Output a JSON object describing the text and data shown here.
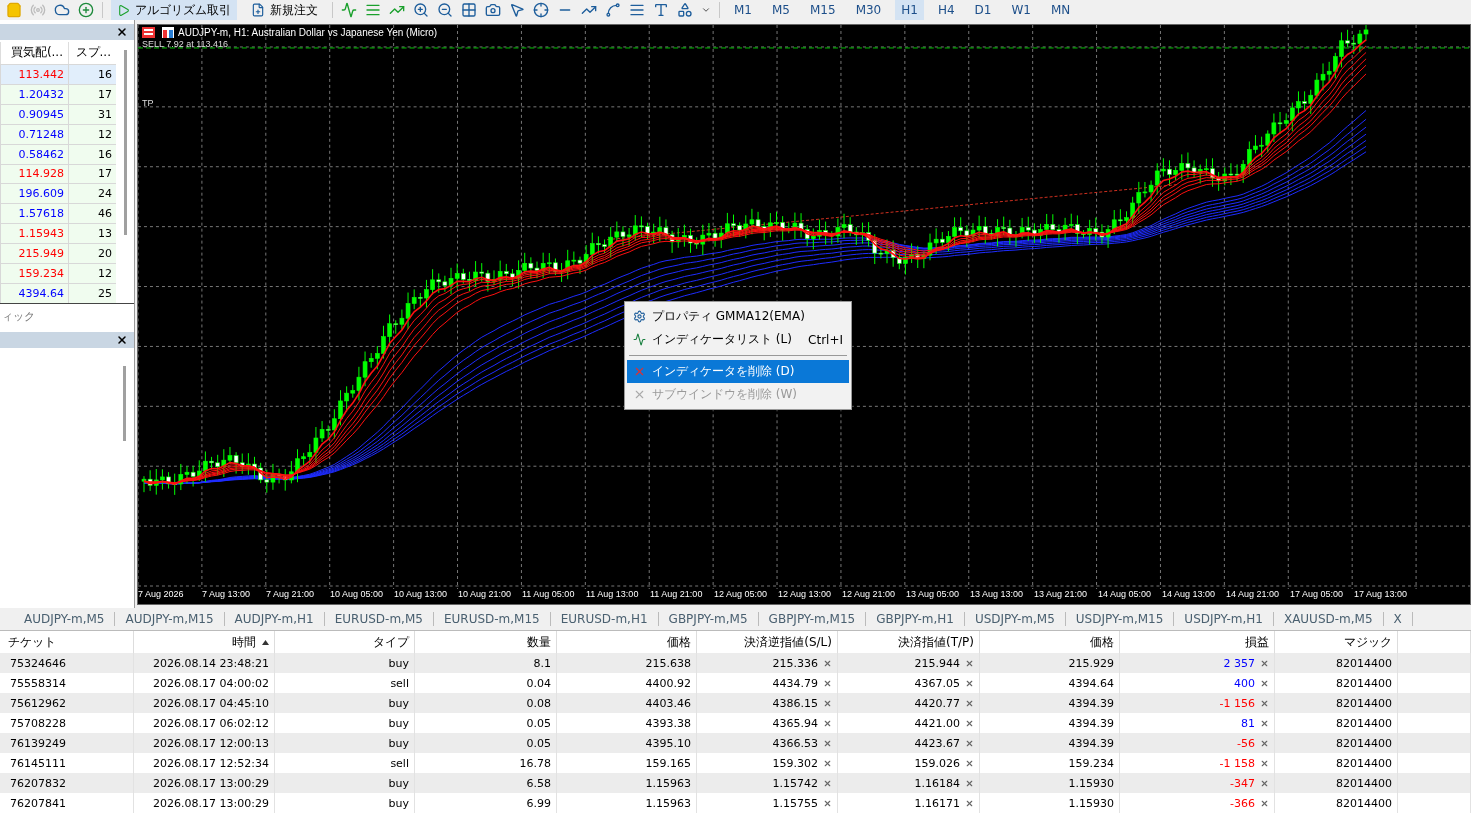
{
  "toolbar": {
    "buttons": [
      {
        "label": "アルゴリズム取引",
        "kind": "algo"
      },
      {
        "label": "新規注文",
        "kind": "order"
      }
    ],
    "timeframes": [
      {
        "label": "M1",
        "selected": false
      },
      {
        "label": "M5",
        "selected": false
      },
      {
        "label": "M15",
        "selected": false
      },
      {
        "label": "M30",
        "selected": false
      },
      {
        "label": "H1",
        "selected": true
      },
      {
        "label": "H4",
        "selected": false
      },
      {
        "label": "D1",
        "selected": false
      },
      {
        "label": "W1",
        "selected": false
      },
      {
        "label": "MN",
        "selected": false
      }
    ]
  },
  "market_watch": {
    "columns": [
      "買気配(...",
      "スプ..."
    ],
    "rows": [
      {
        "bid": "113.442",
        "spread": "16",
        "color": "#ff0000",
        "selected": true
      },
      {
        "bid": "1.20432",
        "spread": "17",
        "color": "#0000ff",
        "selected": false
      },
      {
        "bid": "0.90945",
        "spread": "31",
        "color": "#0000ff",
        "selected": false
      },
      {
        "bid": "0.71248",
        "spread": "12",
        "color": "#0000ff",
        "selected": false
      },
      {
        "bid": "0.58462",
        "spread": "16",
        "color": "#0000ff",
        "selected": false
      },
      {
        "bid": "114.928",
        "spread": "17",
        "color": "#ff0000",
        "selected": false
      },
      {
        "bid": "196.609",
        "spread": "24",
        "color": "#0000ff",
        "selected": false
      },
      {
        "bid": "1.57618",
        "spread": "46",
        "color": "#0000ff",
        "selected": false
      },
      {
        "bid": "1.15943",
        "spread": "13",
        "color": "#ff0000",
        "selected": false
      },
      {
        "bid": "215.949",
        "spread": "20",
        "color": "#ff0000",
        "selected": false
      },
      {
        "bid": "159.234",
        "spread": "12",
        "color": "#ff0000",
        "selected": false
      },
      {
        "bid": "4394.64",
        "spread": "25",
        "color": "#0000ff",
        "selected": false
      }
    ],
    "tab_label": "ィック"
  },
  "chart": {
    "title": "AUDJPY-m, H1:  Australian Dollar vs Japanese Yen (Micro)",
    "order_label": "SELL 7.92 at 113.416",
    "tp_label": "TP",
    "time_labels": [
      "7 Aug 2026",
      "7 Aug 13:00",
      "7 Aug 21:00",
      "10 Aug 05:00",
      "10 Aug 13:00",
      "10 Aug 21:00",
      "11 Aug 05:00",
      "11 Aug 13:00",
      "11 Aug 21:00",
      "12 Aug 05:00",
      "12 Aug 13:00",
      "12 Aug 21:00",
      "13 Aug 05:00",
      "13 Aug 13:00",
      "13 Aug 21:00",
      "14 Aug 05:00",
      "14 Aug 13:00",
      "14 Aug 21:00",
      "17 Aug 05:00",
      "17 Aug 13:00"
    ]
  },
  "context_menu": {
    "items": [
      {
        "kind": "settings",
        "label": "プロパティ GMMA12(EMA)",
        "selected": false,
        "disabled": false
      },
      {
        "kind": "indicators",
        "label": "インディケータリスト (L)",
        "shortcut": "Ctrl+I",
        "selected": false,
        "disabled": false
      },
      {
        "kind": "separator"
      },
      {
        "kind": "remove",
        "label": "インディケータを削除 (D)",
        "selected": true,
        "disabled": false
      },
      {
        "kind": "remove",
        "label": "サブウインドウを削除 (W)",
        "selected": false,
        "disabled": true
      }
    ]
  },
  "symbol_tabs": [
    "AUDJPY-m,M5",
    "AUDJPY-m,M15",
    "AUDJPY-m,H1",
    "EURUSD-m,M5",
    "EURUSD-m,M15",
    "EURUSD-m,H1",
    "GBPJPY-m,M5",
    "GBPJPY-m,M15",
    "GBPJPY-m,H1",
    "USDJPY-m,M5",
    "USDJPY-m,M15",
    "USDJPY-m,H1",
    "XAUUSD-m,M5",
    "X"
  ],
  "trade_table": {
    "columns": [
      {
        "label": "チケット",
        "sorted": false
      },
      {
        "label": "時間",
        "sorted": true
      },
      {
        "label": "タイプ",
        "sorted": false
      },
      {
        "label": "数量",
        "sorted": false
      },
      {
        "label": "価格",
        "sorted": false
      },
      {
        "label": "決済逆指値(S/L)",
        "sorted": false
      },
      {
        "label": "決済指値(T/P)",
        "sorted": false
      },
      {
        "label": "価格",
        "sorted": false
      },
      {
        "label": "損益",
        "sorted": false
      },
      {
        "label": "マジック",
        "sorted": false
      }
    ],
    "rows": [
      {
        "ticket": "75324646",
        "time": "2026.08.14 23:48:21",
        "type": "buy",
        "volume": "8.1",
        "price": "215.638",
        "sl": "215.336",
        "tp": "215.944",
        "current": "215.929",
        "profit": "2 357",
        "color": "#0000ff",
        "magic": "82014400"
      },
      {
        "ticket": "75558314",
        "time": "2026.08.17 04:00:02",
        "type": "sell",
        "volume": "0.04",
        "price": "4400.92",
        "sl": "4434.79",
        "tp": "4367.05",
        "current": "4394.64",
        "profit": "400",
        "color": "#0000ff",
        "magic": "82014400"
      },
      {
        "ticket": "75612962",
        "time": "2026.08.17 04:45:10",
        "type": "buy",
        "volume": "0.08",
        "price": "4403.46",
        "sl": "4386.15",
        "tp": "4420.77",
        "current": "4394.39",
        "profit": "-1 156",
        "color": "#ff0000",
        "magic": "82014400"
      },
      {
        "ticket": "75708228",
        "time": "2026.08.17 06:02:12",
        "type": "buy",
        "volume": "0.05",
        "price": "4393.38",
        "sl": "4365.94",
        "tp": "4421.00",
        "current": "4394.39",
        "profit": "81",
        "color": "#0000ff",
        "magic": "82014400"
      },
      {
        "ticket": "76139249",
        "time": "2026.08.17 12:00:13",
        "type": "buy",
        "volume": "0.05",
        "price": "4395.10",
        "sl": "4366.53",
        "tp": "4423.67",
        "current": "4394.39",
        "profit": "-56",
        "color": "#ff0000",
        "magic": "82014400"
      },
      {
        "ticket": "76145111",
        "time": "2026.08.17 12:52:34",
        "type": "sell",
        "volume": "16.78",
        "price": "159.165",
        "sl": "159.302",
        "tp": "159.026",
        "current": "159.234",
        "profit": "-1 158",
        "color": "#ff0000",
        "magic": "82014400"
      },
      {
        "ticket": "76207832",
        "time": "2026.08.17 13:00:29",
        "type": "buy",
        "volume": "6.58",
        "price": "1.15963",
        "sl": "1.15742",
        "tp": "1.16184",
        "current": "1.15930",
        "profit": "-347",
        "color": "#ff0000",
        "magic": "82014400"
      },
      {
        "ticket": "76207841",
        "time": "2026.08.17 13:00:29",
        "type": "buy",
        "volume": "6.99",
        "price": "1.15963",
        "sl": "1.15755",
        "tp": "1.16171",
        "current": "1.15930",
        "profit": "-366",
        "color": "#ff0000",
        "magic": "82014400"
      }
    ]
  }
}
